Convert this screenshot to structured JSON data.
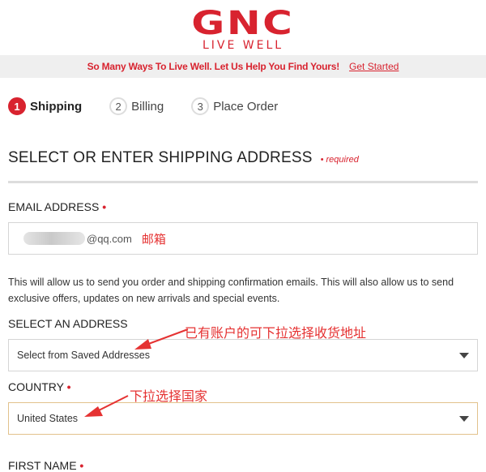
{
  "brand": {
    "logo_main": "GNC",
    "logo_sub": "LIVE WELL"
  },
  "promo": {
    "text": "So Many Ways To Live Well. Let Us Help You Find Yours!",
    "link": "Get Started"
  },
  "steps": [
    {
      "num": "1",
      "label": "Shipping"
    },
    {
      "num": "2",
      "label": "Billing"
    },
    {
      "num": "3",
      "label": "Place Order"
    }
  ],
  "section": {
    "title": "SELECT OR ENTER SHIPPING ADDRESS",
    "required": "• required"
  },
  "email": {
    "label": "EMAIL ADDRESS",
    "required_dot": "•",
    "value_suffix": "@qq.com",
    "annotation": "邮箱"
  },
  "info_text": "This will allow us to send you order and shipping confirmation emails.   This will also allow us to send exclusive offers, updates on new arrivals and special events.",
  "address_select": {
    "label": "SELECT AN ADDRESS",
    "value": "Select from Saved Addresses",
    "annotation": "已有账户的可下拉选择收货地址"
  },
  "country": {
    "label": "COUNTRY",
    "required_dot": "•",
    "value": "United States",
    "annotation": "下拉选择国家"
  },
  "first_name": {
    "label": "FIRST NAME",
    "required_dot": "•"
  },
  "colors": {
    "brand_red": "#d8232f",
    "annotation_red": "#e53232"
  },
  "icons": {
    "dropdown": "caret-down-icon",
    "arrow": "annotation-arrow-icon"
  }
}
